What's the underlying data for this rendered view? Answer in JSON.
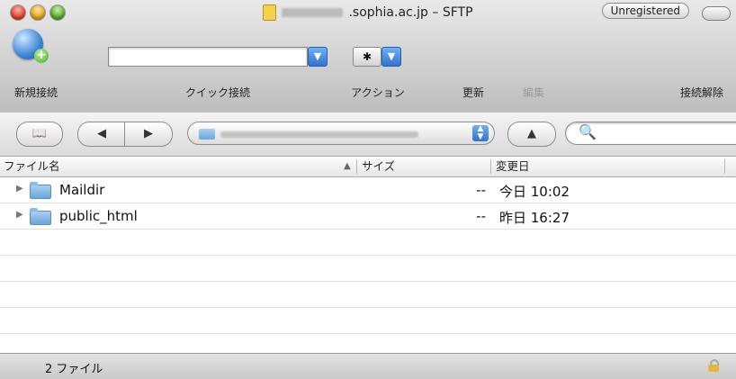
{
  "window": {
    "title_suffix": ".sophia.ac.jp – SFTP",
    "unregistered_label": "Unregistered"
  },
  "toolbar": {
    "new_connection": "新規接続",
    "quick_connect": "クイック接続",
    "action": "アクション",
    "refresh": "更新",
    "edit": "編集",
    "disconnect": "接続解除"
  },
  "nav": {
    "back_glyph": "◀",
    "forward_glyph": "▶",
    "up_glyph": "▲",
    "book_glyph": "📖",
    "search_glyph": "🔍"
  },
  "columns": {
    "name": "ファイル名",
    "size": "サイズ",
    "modified": "変更日",
    "sort_indicator": "▲"
  },
  "files": [
    {
      "name": "Maildir",
      "size": "--",
      "modified": "今日 10:02"
    },
    {
      "name": "public_html",
      "size": "--",
      "modified": "昨日 16:27"
    }
  ],
  "status": {
    "item_count": "2 ファイル"
  }
}
